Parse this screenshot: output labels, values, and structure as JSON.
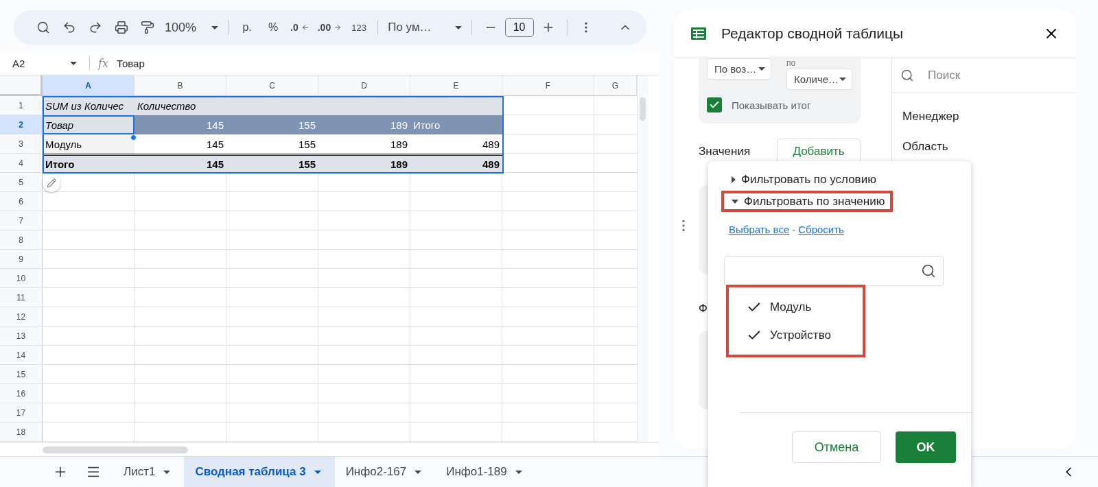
{
  "toolbar": {
    "zoom": "100%",
    "currency": "р.",
    "percent": "%",
    "decimal_decrease": ".0",
    "decimal_increase": ".00",
    "number_format": "123",
    "font": "По ум…",
    "font_size": "10"
  },
  "formula_bar": {
    "cell": "A2",
    "fx": "fx",
    "value": "Товар"
  },
  "sheet": {
    "columns": [
      {
        "label": "A",
        "selected": true
      },
      {
        "label": "B",
        "selected": false
      },
      {
        "label": "C",
        "selected": false
      },
      {
        "label": "D",
        "selected": false
      },
      {
        "label": "E",
        "selected": false
      },
      {
        "label": "F",
        "selected": false
      },
      {
        "label": "G",
        "selected": false
      }
    ],
    "rows": [
      {
        "label": "1",
        "selected": false,
        "kind": "title",
        "cells": [
          {
            "text": "SUM из Количес",
            "kind": "text",
            "selected": false
          },
          {
            "text": "Количество",
            "kind": "text",
            "selected": false
          }
        ]
      },
      {
        "label": "2",
        "selected": true,
        "kind": "header",
        "cells": [
          {
            "text": "Товар",
            "kind": "text",
            "selected": true
          },
          {
            "text": "145",
            "kind": "number",
            "selected": false
          },
          {
            "text": "155",
            "kind": "number",
            "selected": false
          },
          {
            "text": "189",
            "kind": "number",
            "selected": false
          },
          {
            "text": "Итого",
            "kind": "text",
            "selected": false
          }
        ]
      },
      {
        "label": "3",
        "selected": false,
        "kind": "data",
        "cells": [
          {
            "text": "Модуль",
            "kind": "text",
            "selected": false
          },
          {
            "text": "145",
            "kind": "number",
            "selected": false
          },
          {
            "text": "155",
            "kind": "number",
            "selected": false
          },
          {
            "text": "189",
            "kind": "number",
            "selected": false
          },
          {
            "text": "489",
            "kind": "number",
            "selected": false
          }
        ]
      },
      {
        "label": "4",
        "selected": false,
        "kind": "total",
        "cells": [
          {
            "text": "Итого",
            "kind": "text",
            "selected": false
          },
          {
            "text": "145",
            "kind": "number",
            "selected": false
          },
          {
            "text": "155",
            "kind": "number",
            "selected": false
          },
          {
            "text": "189",
            "kind": "number",
            "selected": false
          },
          {
            "text": "489",
            "kind": "number",
            "selected": false
          }
        ]
      },
      {
        "label": "5",
        "selected": false
      },
      {
        "label": "6",
        "selected": false
      },
      {
        "label": "7",
        "selected": false
      },
      {
        "label": "8",
        "selected": false
      },
      {
        "label": "9",
        "selected": false
      },
      {
        "label": "10",
        "selected": false
      },
      {
        "label": "11",
        "selected": false
      },
      {
        "label": "12",
        "selected": false
      },
      {
        "label": "13",
        "selected": false
      },
      {
        "label": "14",
        "selected": false
      },
      {
        "label": "15",
        "selected": false
      },
      {
        "label": "16",
        "selected": false
      },
      {
        "label": "17",
        "selected": false
      },
      {
        "label": "18",
        "selected": false
      }
    ]
  },
  "sheet_tabs": [
    {
      "label": "Лист1",
      "selected": false
    },
    {
      "label": "Сводная таблица 3",
      "selected": true
    },
    {
      "label": "Инфо2-167",
      "selected": false
    },
    {
      "label": "Инфо1-189",
      "selected": false
    }
  ],
  "editor": {
    "title": "Редактор сводной таблицы",
    "sort_order": "По воз…",
    "sort_by_label": "по",
    "sort_by": "Количе…",
    "show_totals": {
      "label": "Показывать итог",
      "checked": true
    },
    "values_label": "Значения",
    "add_button": "Добавить",
    "filters_label": "Ф",
    "field_search": {
      "placeholder": "Поиск"
    },
    "fields": [
      "Менеджер",
      "Область"
    ]
  },
  "filter_popup": {
    "sections": [
      {
        "label": "Фильтровать по условию",
        "expanded": false,
        "highlighted": false
      },
      {
        "label": "Фильтровать по значению",
        "expanded": true,
        "highlighted": true
      }
    ],
    "select_all": "Выбрать все",
    "separator": "-",
    "reset": "Сбросить",
    "values": {
      "highlighted": true,
      "items": [
        {
          "label": "Модуль",
          "checked": true
        },
        {
          "label": "Устройство",
          "checked": true
        }
      ]
    },
    "cancel": "Отмена",
    "ok": "OK"
  }
}
